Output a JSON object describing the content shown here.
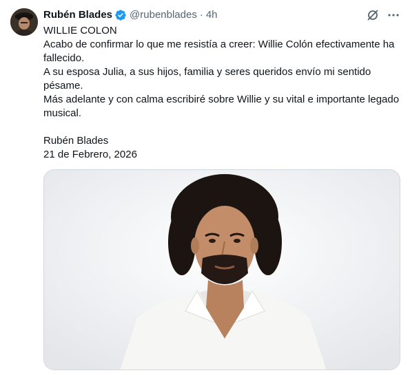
{
  "author": {
    "name": "Rubén Blades",
    "handle": "@rubenblades",
    "separator": "·",
    "time": "4h",
    "verified": true
  },
  "icons": {
    "avatar": "profile-avatar",
    "verified": "verified-badge-icon",
    "grok": "grok-icon",
    "more": "more-icon"
  },
  "tweet": {
    "lines": [
      "WILLIE COLON",
      "Acabo de confirmar lo que me resistía a creer: Willie Colón efectivamente ha fallecido.",
      "A su esposa Julia, a sus hijos, familia y seres queridos envío mi sentido pésame.",
      "Más adelante y con calma escribiré sobre Willie y su vital e importante legado musical."
    ],
    "signature": "Rubén Blades",
    "date": "21 de Febrero, 2026"
  },
  "colors": {
    "accent": "#1d9bf0",
    "text": "#0f1419",
    "secondary": "#536471",
    "border": "#cfd9de"
  }
}
